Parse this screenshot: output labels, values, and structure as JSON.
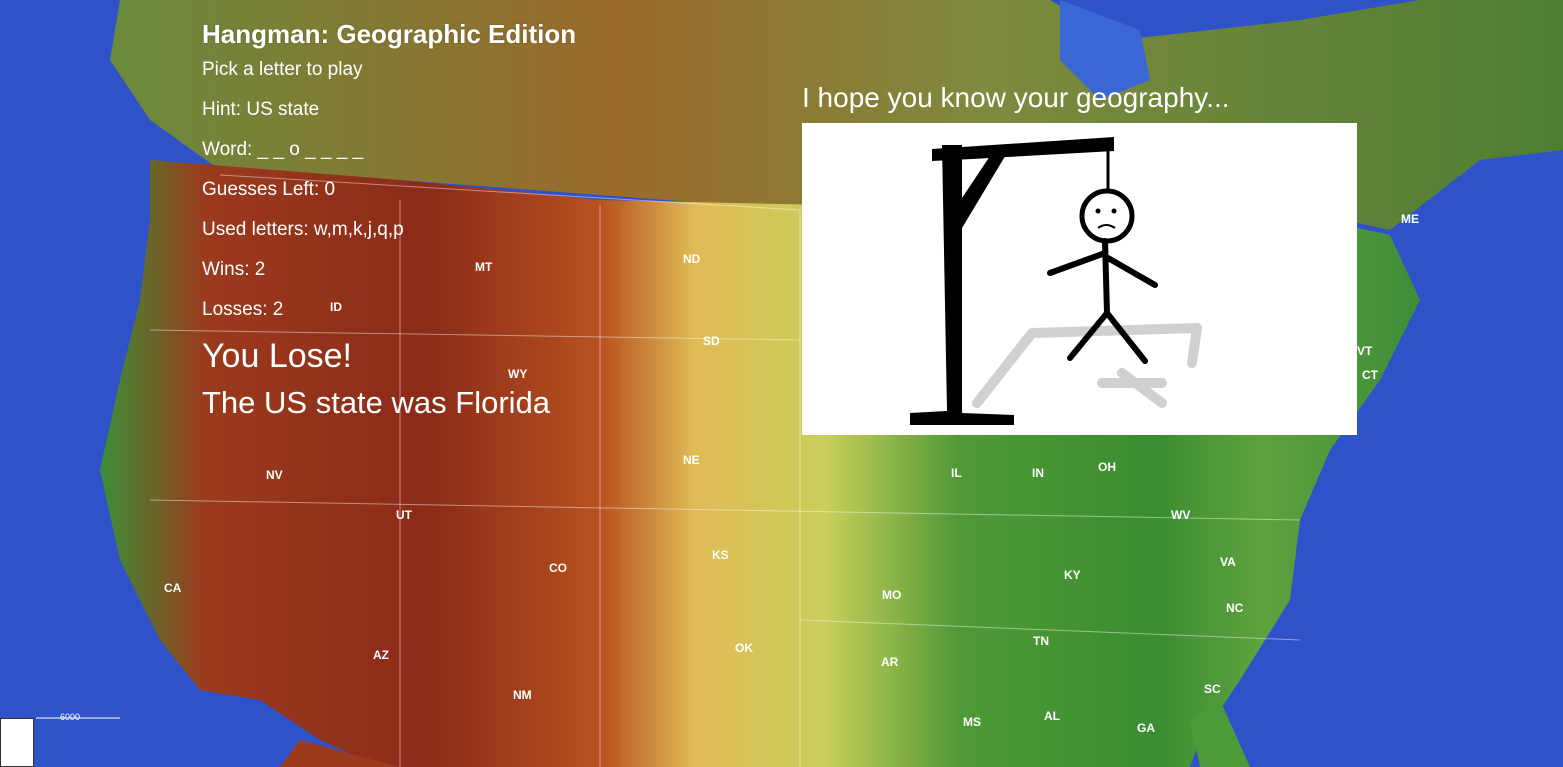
{
  "game": {
    "title": "Hangman: Geographic Edition",
    "instruction": "Pick a letter to play",
    "hint": "Hint: US state",
    "word": "Word: _ _ o _ _ _ _",
    "guesses_left": "Guesses Left: 0",
    "used_letters": "Used letters: w,m,k,j,q,p",
    "wins": "Wins: 2",
    "losses": "Losses: 2",
    "result": "You Lose!",
    "answer": "The US state was Florida"
  },
  "panel": {
    "tagline": "I hope you know your geography..."
  },
  "map": {
    "state_labels": [
      "MT",
      "ND",
      "SD",
      "WY",
      "ID",
      "NV",
      "UT",
      "CO",
      "NE",
      "KS",
      "OK",
      "AZ",
      "NM",
      "CA",
      "IL",
      "IN",
      "OH",
      "KY",
      "TN",
      "MO",
      "AR",
      "MS",
      "AL",
      "GA",
      "SC",
      "NC",
      "VA",
      "WV",
      "ME",
      "VT",
      "CT"
    ],
    "scale_label": "6000",
    "colors": {
      "ocean": "#2f52c9",
      "lowland": "#3f9a3a",
      "plains": "#e3c35a",
      "highland": "#b5541e",
      "mountain": "#8a2a1a",
      "canada": "#5e7a3b"
    }
  },
  "icons": {
    "hangman": "hangman-figure-icon"
  }
}
